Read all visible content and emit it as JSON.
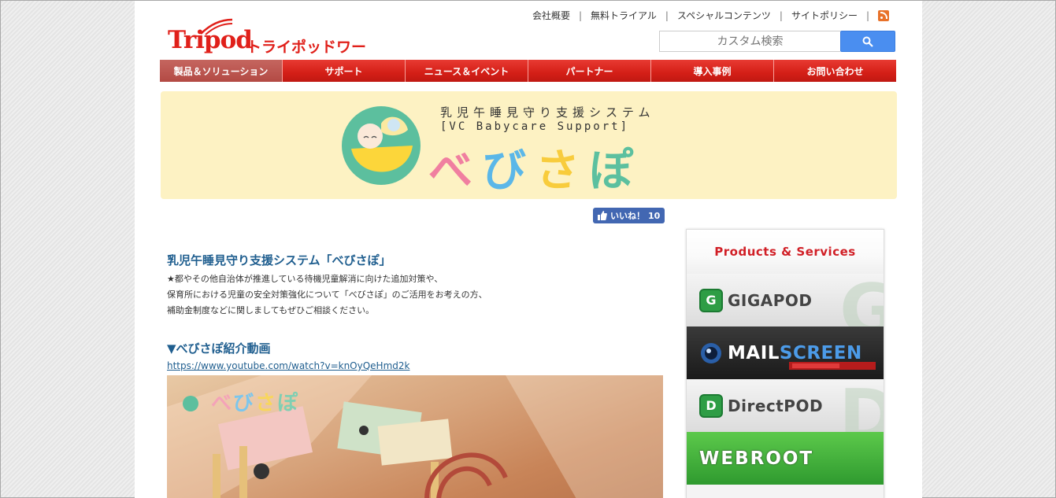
{
  "top_links": [
    "会社概要",
    "無料トライアル",
    "スペシャルコンテンツ",
    "サイトポリシー"
  ],
  "logo": {
    "brand": "Tripod",
    "company": "トライポッドワークス"
  },
  "search": {
    "placeholder": "カスタム検索"
  },
  "nav": [
    {
      "label": "製品＆ソリューション",
      "active": true
    },
    {
      "label": "サポート"
    },
    {
      "label": "ニュース＆イベント"
    },
    {
      "label": "パートナー"
    },
    {
      "label": "導入事例"
    },
    {
      "label": "お問い合わせ"
    }
  ],
  "banner": {
    "subtitle_jp": "乳児午睡見守り支援システム",
    "subtitle_en": "[VC Babycare Support]",
    "title_chars": [
      "べ",
      "び",
      "さ",
      "ぽ"
    ]
  },
  "like": {
    "label": "いいね！",
    "count": "10"
  },
  "main": {
    "heading": "乳児午睡見守り支援システム「べびさぽ」",
    "lines": [
      "★都やその他自治体が推進している待機児童解消に向けた追加対策や、",
      "保育所における児童の安全対策強化について「べびさぽ」のご活用をお考えの方、",
      "補助金制度などに関しましてもぜひご相談ください。"
    ],
    "video_heading": "▼べびさぽ紹介動画",
    "video_link": "https://www.youtube.com/watch?v=knOyQeHmd2k"
  },
  "sidebar": {
    "title": "Products & Services",
    "products": [
      {
        "name": "GIGAPOD",
        "badge": "G"
      },
      {
        "name_a": "MAIL",
        "name_b": "SCREEN"
      },
      {
        "name": "DirectPOD",
        "badge": "D"
      },
      {
        "name": "WEBROOT"
      }
    ]
  },
  "colors": {
    "brand_red": "#e0201a",
    "nav_red": "#d41f17",
    "banner_bg": "#fdf2c3",
    "link_blue": "#1f5e8f",
    "search_blue": "#4a8ef0"
  }
}
